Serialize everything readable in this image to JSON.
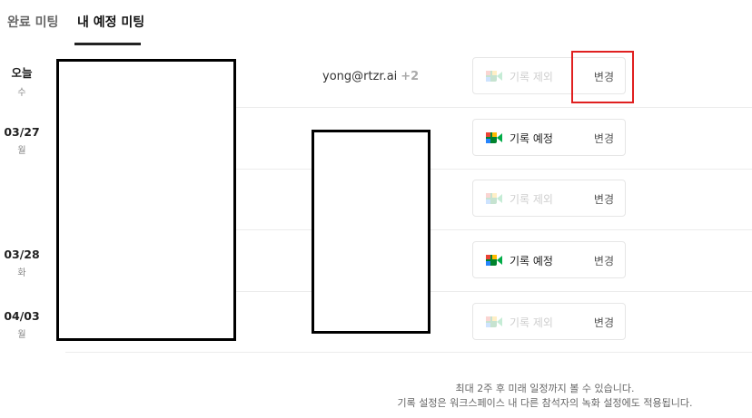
{
  "tabs": {
    "completed": "완료 미팅",
    "my_schedule": "내 예정 미팅"
  },
  "dates": [
    {
      "day": "오늘",
      "weekday": "수"
    },
    {
      "day": "03/27",
      "weekday": "월"
    },
    {
      "day": "03/28",
      "weekday": "화"
    },
    {
      "day": "04/03",
      "weekday": "월"
    }
  ],
  "attendee": {
    "email": "yong@rtzr.ai",
    "more": "+2"
  },
  "meetings": [
    {
      "record_label": "기록 제외",
      "change_label": "변경",
      "status": "excluded"
    },
    {
      "record_label": "기록 예정",
      "change_label": "변경",
      "status": "scheduled"
    },
    {
      "record_label": "기록 제외",
      "change_label": "변경",
      "status": "excluded"
    },
    {
      "record_label": "기록 예정",
      "change_label": "변경",
      "status": "scheduled"
    },
    {
      "record_label": "기록 제외",
      "change_label": "변경",
      "status": "excluded"
    }
  ],
  "footer": {
    "line1": "최대 2주 후 미래 일정까지 볼 수 있습니다.",
    "line2": "기록 설정은 워크스페이스 내 다른 참석자의 녹화 설정에도 적용됩니다."
  },
  "icons": {
    "record": "google-meet-icon"
  },
  "colors": {
    "highlight": "#e02020",
    "meet_green": "#00832d",
    "meet_blue": "#2684fc",
    "meet_yellow": "#ffba00",
    "meet_red": "#ea4335"
  }
}
